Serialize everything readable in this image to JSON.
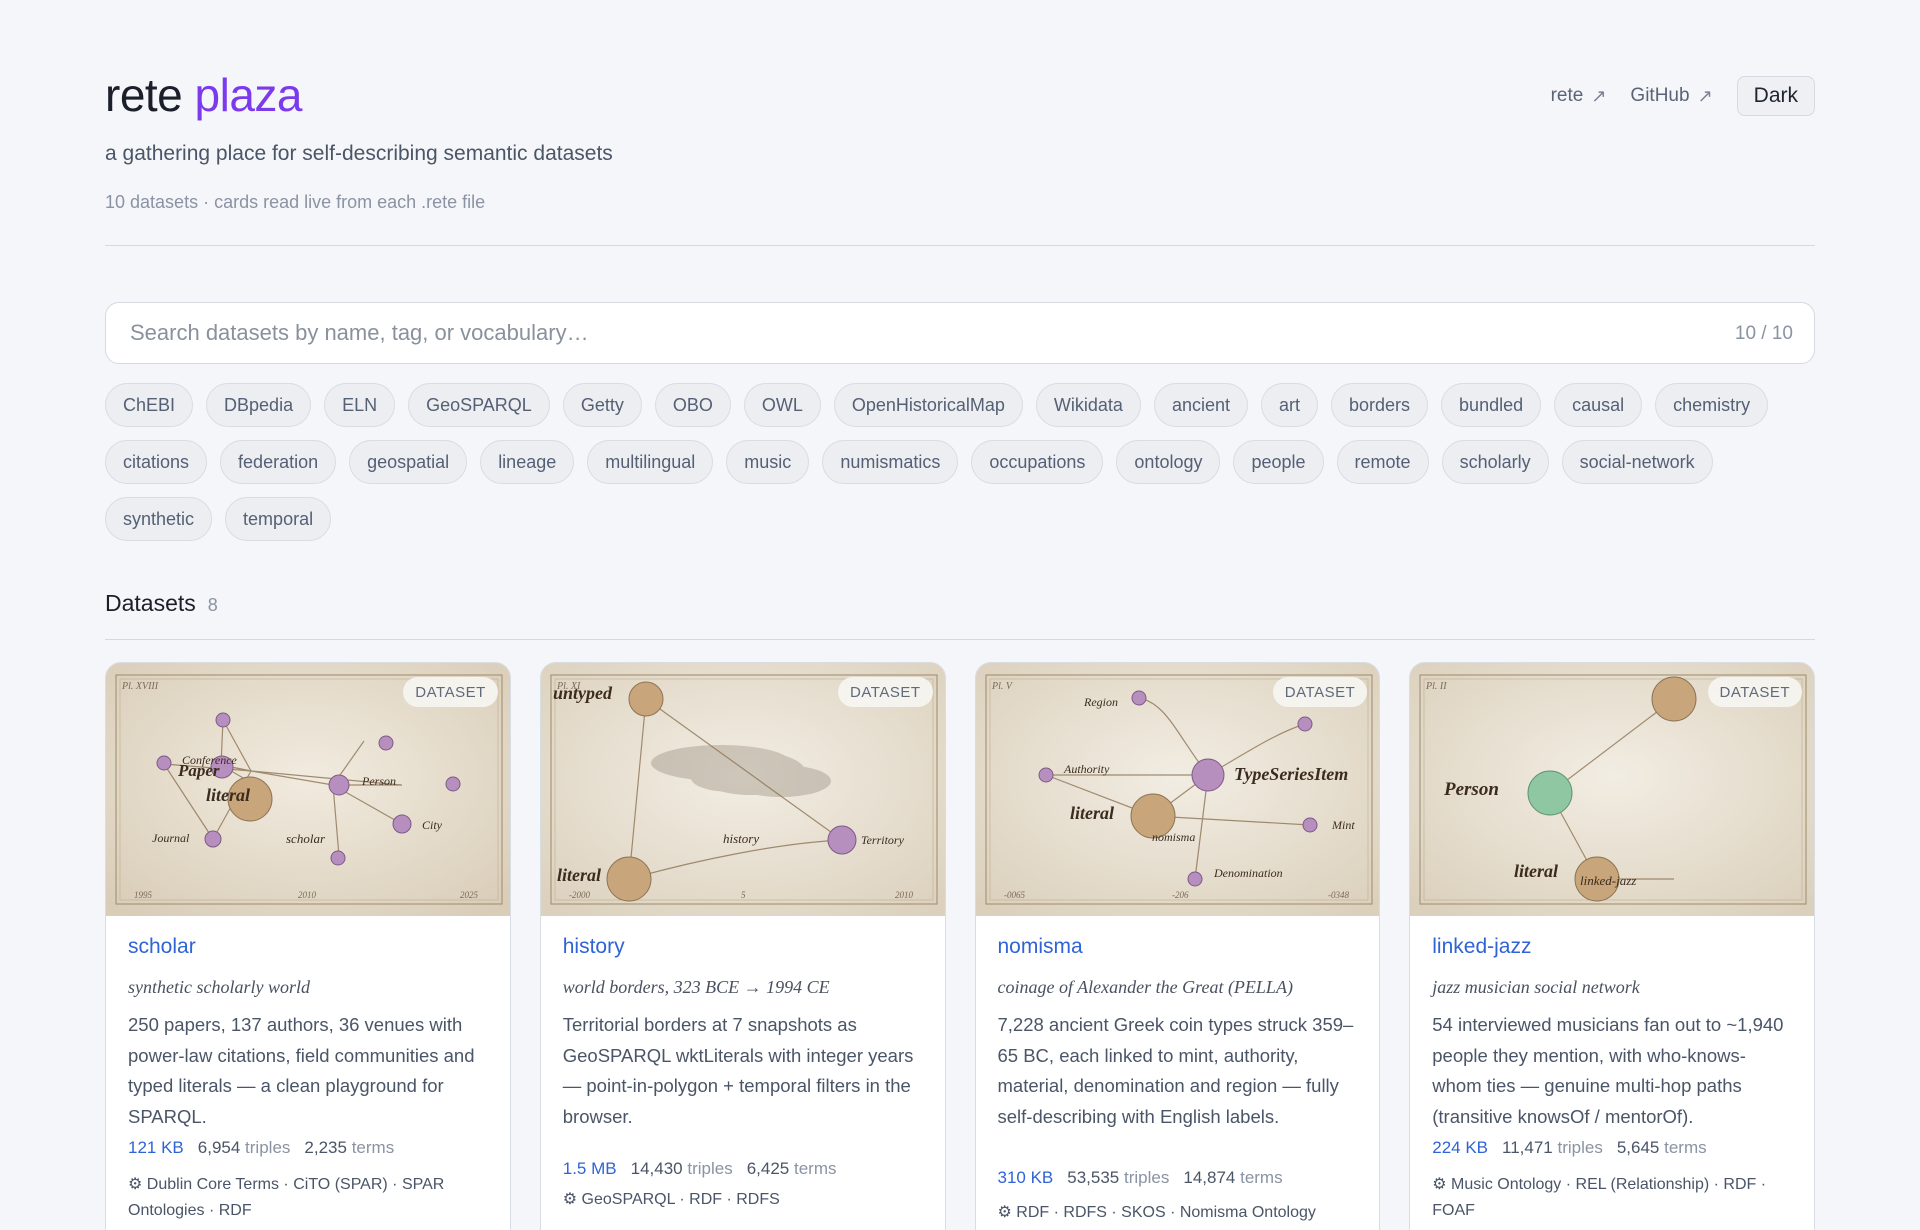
{
  "header": {
    "brand_main": "rete",
    "brand_accent": "plaza",
    "tagline": "a gathering place for self-describing semantic datasets",
    "meta": "10 datasets · cards read live from each .rete file",
    "nav": [
      {
        "label": "rete",
        "icon": "arrow-up-right-icon"
      },
      {
        "label": "GitHub",
        "icon": "arrow-up-right-icon"
      }
    ],
    "theme_button": "Dark"
  },
  "search": {
    "placeholder": "Search datasets by name, tag, or vocabulary…",
    "count": "10 / 10"
  },
  "tags": [
    "ChEBI",
    "DBpedia",
    "ELN",
    "GeoSPARQL",
    "Getty",
    "OBO",
    "OWL",
    "OpenHistoricalMap",
    "Wikidata",
    "ancient",
    "art",
    "borders",
    "bundled",
    "causal",
    "chemistry",
    "citations",
    "federation",
    "geospatial",
    "lineage",
    "multilingual",
    "music",
    "numismatics",
    "occupations",
    "ontology",
    "people",
    "remote",
    "scholarly",
    "social-network",
    "synthetic",
    "temporal"
  ],
  "section": {
    "title": "Datasets",
    "count": "8"
  },
  "cards": [
    {
      "badge": "DATASET",
      "name": "scholar",
      "subtitle": "synthetic scholarly world",
      "description": "250 papers, 137 authors, 36 venues with power-law citations, field communities and typed literals — a clean playground for SPARQL.",
      "size": "121 KB",
      "triples": "6,954",
      "triples_label": "triples",
      "terms": "2,235",
      "terms_label": "terms",
      "vocab": "⚙ Dublin Core Terms · CiTO (SPAR) · SPAR Ontologies · RDF",
      "plate": {
        "plate_no": "Pl. XVIII",
        "axis": [
          "1995",
          "2010",
          "2025"
        ],
        "labels": [
          "Conference",
          "Paper",
          "literal",
          "Person",
          "Journal",
          "scholar",
          "City"
        ]
      }
    },
    {
      "badge": "DATASET",
      "name": "history",
      "subtitle": "world borders, 323 BCE → 1994 CE",
      "description": "Territorial borders at 7 snapshots as GeoSPARQL wktLiterals with integer years — point-in-polygon + temporal filters in the browser.",
      "size": "1.5 MB",
      "triples": "14,430",
      "triples_label": "triples",
      "terms": "6,425",
      "terms_label": "terms",
      "vocab": "⚙ GeoSPARQL · RDF · RDFS",
      "plate": {
        "plate_no": "Pl. XI",
        "axis": [
          "-2000",
          "5",
          "2010"
        ],
        "labels": [
          "untyped",
          "history",
          "Territory",
          "literal"
        ]
      }
    },
    {
      "badge": "DATASET",
      "name": "nomisma",
      "subtitle": "coinage of Alexander the Great (PELLA)",
      "description": "7,228 ancient Greek coin types struck 359–65 BC, each linked to mint, authority, material, denomination and region — fully self-describing with English labels.",
      "size": "310 KB",
      "triples": "53,535",
      "triples_label": "triples",
      "terms": "14,874",
      "terms_label": "terms",
      "vocab": "⚙ RDF · RDFS · SKOS · Nomisma Ontology",
      "plate": {
        "plate_no": "Pl. V",
        "axis": [
          "-0065",
          "-206",
          "-0348"
        ],
        "labels": [
          "Region",
          "Authority",
          "TypeSeriesItem",
          "literal",
          "nomisma",
          "Mint",
          "Denomination"
        ]
      }
    },
    {
      "badge": "DATASET",
      "name": "linked-jazz",
      "subtitle": "jazz musician social network",
      "description": "54 interviewed musicians fan out to ~1,940 people they mention, with who-knows-whom ties — genuine multi-hop paths (transitive knowsOf / mentorOf).",
      "size": "224 KB",
      "triples": "11,471",
      "triples_label": "triples",
      "terms": "5,645",
      "terms_label": "terms",
      "vocab": "⚙ Music Ontology · REL (Relationship) · RDF · FOAF",
      "plate": {
        "plate_no": "Pl. II",
        "labels": [
          "Person",
          "literal",
          "linked-jazz"
        ]
      }
    }
  ]
}
